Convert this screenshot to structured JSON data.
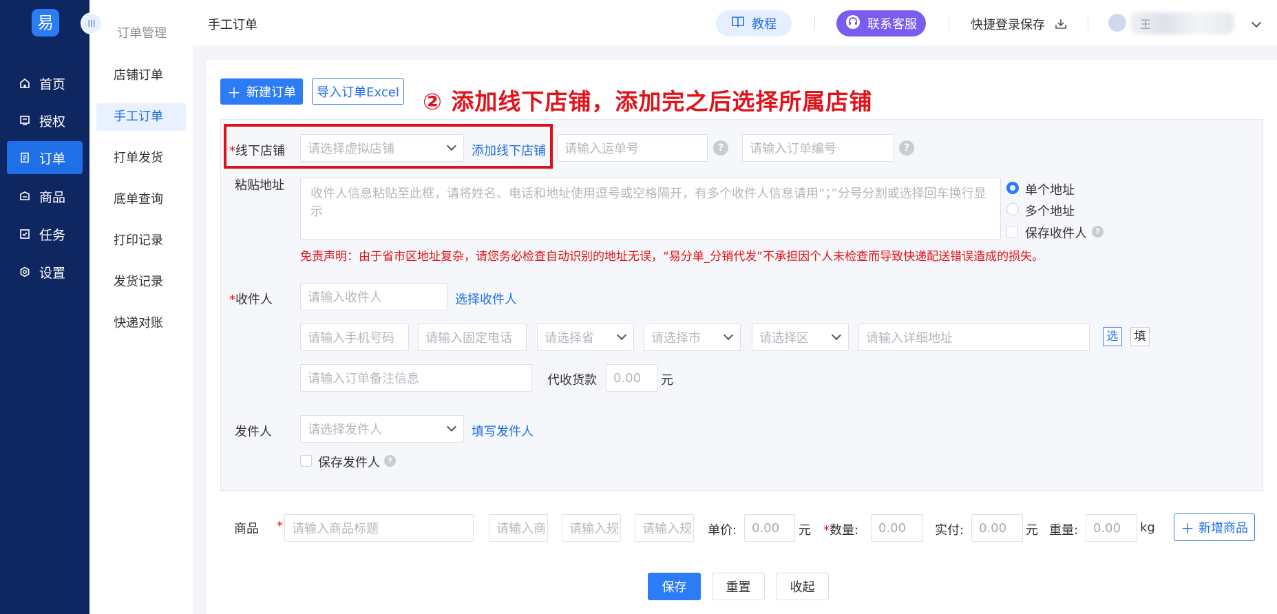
{
  "nav": {
    "logo": "易",
    "items": [
      {
        "label": "首页",
        "icon": "home-icon"
      },
      {
        "label": "授权",
        "icon": "authorize-icon"
      },
      {
        "label": "订单",
        "icon": "order-icon"
      },
      {
        "label": "商品",
        "icon": "product-icon"
      },
      {
        "label": "任务",
        "icon": "task-icon"
      },
      {
        "label": "设置",
        "icon": "settings-icon"
      }
    ],
    "active": "订单"
  },
  "subnav": {
    "title": "订单管理",
    "collapse_glyph": "III",
    "items": [
      "店铺订单",
      "手工订单",
      "打单发货",
      "底单查询",
      "打印记录",
      "发货记录",
      "快递对账"
    ],
    "active": "手工订单"
  },
  "header": {
    "title": "手工订单",
    "tutorial": "教程",
    "service": "联系客服",
    "quick_save": "快捷登录保存",
    "user_initial": "王"
  },
  "toolbar": {
    "new_order": "新建订单",
    "import_excel": "导入订单Excel"
  },
  "annotation": "② 添加线下店铺，添加完之后选择所属店铺",
  "form": {
    "store": {
      "label": "线下店铺",
      "placeholder": "请选择虚拟店铺",
      "add_link": "添加线下店铺"
    },
    "waybill_placeholder": "请输入运单号",
    "order_no_placeholder": "请输入订单编号",
    "paste": {
      "label": "粘贴地址",
      "placeholder": "收件人信息粘贴至此框，请将姓名、电话和地址使用逗号或空格隔开，有多个收件人信息请用“；”分号分割或选择回车换行显示",
      "single": "单个地址",
      "multi": "多个地址",
      "save_receiver": "保存收件人"
    },
    "disclaimer": "免责声明：由于省市区地址复杂，请您务必检查自动识别的地址无误，“易分单_分销代发”不承担因个人未检查而导致快递配送错误造成的损失。",
    "receiver": {
      "label": "收件人",
      "placeholder": "请输入收件人",
      "choose_link": "选择收件人",
      "mobile": "请输入手机号码",
      "phone": "请输入固定电话",
      "province": "请选择省",
      "city": "请选择市",
      "district": "请选择区",
      "address": "请输入详细地址",
      "pick_btn": "选",
      "fill_btn": "填",
      "remark": "请输入订单备注信息",
      "cod_label": "代收货款",
      "cod_value": "0.00",
      "yuan": "元"
    },
    "sender": {
      "label": "发件人",
      "placeholder": "请选择发件人",
      "fill_link": "填写发件人",
      "save_sender": "保存发件人"
    },
    "goods": {
      "label": "商品",
      "title_placeholder": "请输入商品标题",
      "ph2": "请输入商",
      "ph3": "请输入规",
      "ph4": "请输入规",
      "price_label": "单价:",
      "price_value": "0.00",
      "yuan": "元",
      "qty_label": "数量:",
      "qty_value": "0.00",
      "paid_label": "实付:",
      "paid_value": "0.00",
      "weight_label": "重量:",
      "weight_value": "0.00",
      "kg": "kg",
      "add_goods": "新增商品"
    },
    "actions": {
      "save": "保存",
      "reset": "重置",
      "collapse": "收起"
    }
  }
}
